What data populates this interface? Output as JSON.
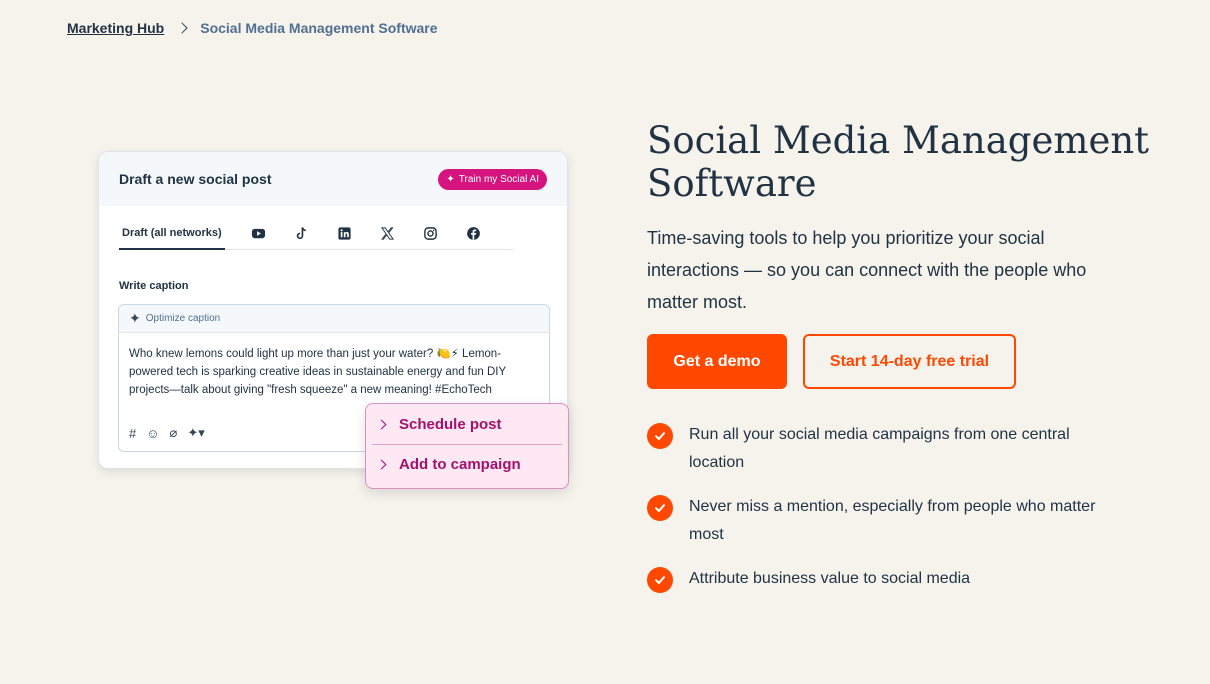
{
  "breadcrumb": {
    "parent": "Marketing Hub",
    "current": "Social Media Management Software"
  },
  "mockup": {
    "card_title": "Draft a new social post",
    "ai_badge": "Train my Social AI",
    "tab_active": "Draft (all networks)",
    "network_icons": [
      "youtube-icon",
      "tiktok-icon",
      "linkedin-icon",
      "x-icon",
      "instagram-icon",
      "facebook-icon"
    ],
    "caption_label": "Write caption",
    "optimize_label": "Optimize caption",
    "caption_text": "Who knew lemons could light up more than just your water? 🍋⚡ Lemon-powered tech is sparking creative ideas in sustainable energy and fun DIY projects—talk about giving \"fresh squeeze\" a new meaning! #EchoTech",
    "popup": {
      "schedule": "Schedule post",
      "campaign": "Add to campaign"
    }
  },
  "hero": {
    "title": "Social Media Management Software",
    "description": "Time-saving tools to help you prioritize your social interactions — so you can connect with the people who matter most.",
    "primary_cta": "Get a demo",
    "secondary_cta": "Start 14-day free trial"
  },
  "features": [
    "Run all your social media campaigns from one central location",
    "Never miss a mention, especially from people who matter most",
    "Attribute business value to social media"
  ],
  "colors": {
    "accent": "#ff4800",
    "background": "#f6f3ed",
    "ai_pink": "#d6147f"
  }
}
